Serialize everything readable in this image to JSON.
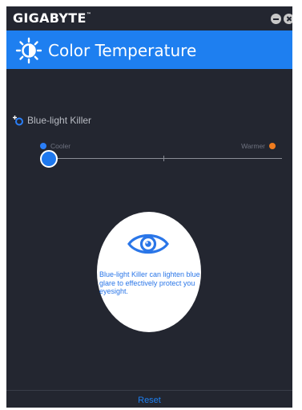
{
  "window": {
    "brand": "GIGABYTE",
    "brand_mark": "™"
  },
  "header": {
    "title": "Color Temperature",
    "icon": "sun-icon"
  },
  "blue_light": {
    "label": "Blue-light Killer",
    "icon": "blue-light-icon",
    "cooler_label": "Cooler",
    "warmer_label": "Warmer",
    "slider_value": 0
  },
  "info": {
    "text": "Blue-light Killer can lighten blue glare to effectively protect you eyesight.",
    "icon": "eye-icon"
  },
  "footer": {
    "reset_label": "Reset"
  },
  "colors": {
    "accent": "#1e7ff0",
    "background": "#232630",
    "cooler": "#2a7ef7",
    "warmer": "#f07c1e"
  }
}
